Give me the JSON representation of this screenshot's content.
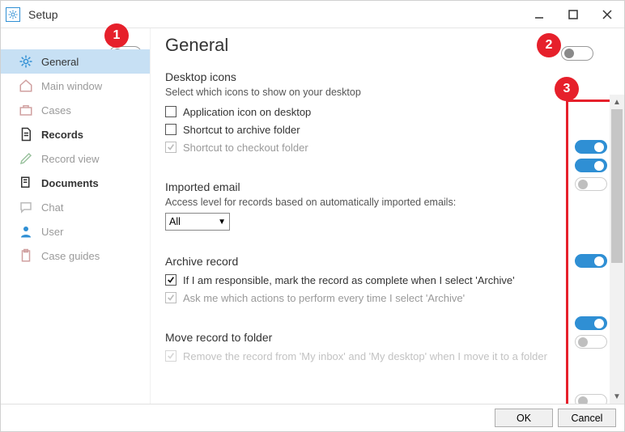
{
  "window": {
    "title": "Setup",
    "buttons": {
      "ok": "OK",
      "cancel": "Cancel"
    }
  },
  "badges": {
    "b1": "1",
    "b2": "2",
    "b3": "3"
  },
  "sidebar": {
    "items": [
      {
        "label": "General"
      },
      {
        "label": "Main window"
      },
      {
        "label": "Cases"
      },
      {
        "label": "Records"
      },
      {
        "label": "Record view"
      },
      {
        "label": "Documents"
      },
      {
        "label": "Chat"
      },
      {
        "label": "User"
      },
      {
        "label": "Case guides"
      }
    ]
  },
  "content": {
    "page_title": "General",
    "desktop_icons": {
      "title": "Desktop icons",
      "subtitle": "Select which icons to show on your desktop",
      "opt1": "Application icon on desktop",
      "opt2": "Shortcut to archive folder",
      "opt3": "Shortcut to checkout folder"
    },
    "imported_email": {
      "title": "Imported email",
      "subtitle": "Access level for records based on automatically imported emails:",
      "select_value": "All"
    },
    "archive_record": {
      "title": "Archive record",
      "opt1": "If I am responsible, mark the record as complete when I select 'Archive'",
      "opt2": "Ask me which actions to perform every time I select 'Archive'"
    },
    "move_record": {
      "title": "Move record to folder",
      "opt1": "Remove the record from 'My inbox' and 'My desktop' when I move it to a folder"
    }
  }
}
